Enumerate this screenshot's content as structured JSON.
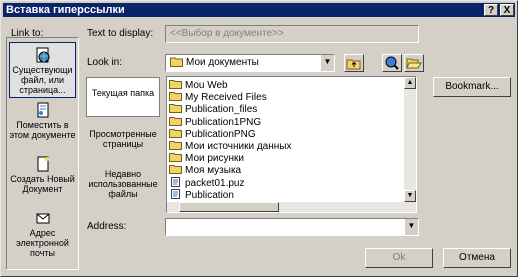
{
  "window": {
    "title": "Вставка гиперссылки",
    "help_label": "?",
    "close_label": "X"
  },
  "link_to": {
    "label": "Link to:",
    "items": [
      {
        "label": "Существующи файл, или страница..."
      },
      {
        "label": "Поместить в этом документе"
      },
      {
        "label": "Создать Новый Документ"
      },
      {
        "label": "Адрес электронной почты"
      }
    ]
  },
  "text_to_display": {
    "label": "Text to display:",
    "value": "<<Выбор в документе>>"
  },
  "look_in": {
    "label": "Look in:",
    "value": "Мои документы",
    "arrow": "▼"
  },
  "side_panel": {
    "items": [
      {
        "label": "Текущая папка"
      },
      {
        "label": "Просмотренные страницы"
      },
      {
        "label": "Недавно использованные файлы"
      }
    ]
  },
  "files": [
    {
      "name": "Mou Web",
      "icon": "folder-icon"
    },
    {
      "name": "My Received Files",
      "icon": "folder-icon"
    },
    {
      "name": "Publication_files",
      "icon": "folder-icon"
    },
    {
      "name": "Publication1PNG",
      "icon": "folder-icon"
    },
    {
      "name": "PublicationPNG",
      "icon": "folder-icon"
    },
    {
      "name": "Мои источники данных",
      "icon": "folder-icon"
    },
    {
      "name": "Мои рисунки",
      "icon": "folder-icon"
    },
    {
      "name": "Моя музыка",
      "icon": "folder-icon"
    },
    {
      "name": "packet01.puz",
      "icon": "file-icon"
    },
    {
      "name": "Publication",
      "icon": "file-icon"
    }
  ],
  "address": {
    "label": "Address:",
    "value": "",
    "arrow": "▼"
  },
  "buttons": {
    "bookmark": "Bookmark...",
    "ok": "Ok",
    "cancel": "Отмена"
  },
  "colors": {
    "title_bar": "#0a246a",
    "dialog_face": "#d4d0c8",
    "folder": "#f2d36b"
  }
}
